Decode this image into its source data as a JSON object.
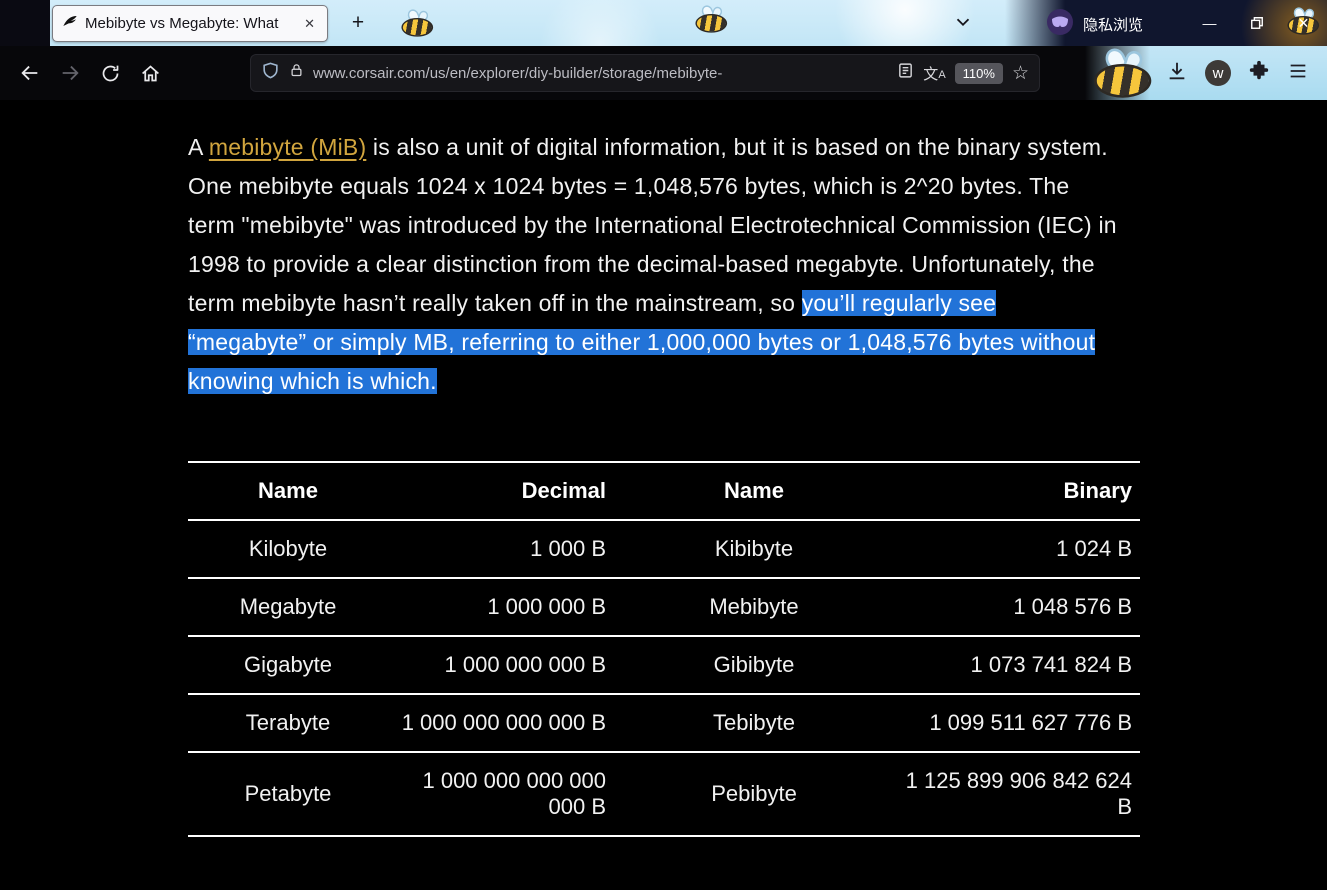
{
  "browser": {
    "tab": {
      "title": "Mebibyte vs Megabyte: What",
      "close_glyph": "✕"
    },
    "new_tab_glyph": "+",
    "private_label": "隐私浏览",
    "window_controls": {
      "minimize": "—",
      "close": "✕"
    },
    "url": "www.corsair.com/us/en/explorer/diy-builder/storage/mebibyte-",
    "zoom_level": "110%",
    "icons": {
      "star": "☆",
      "translate_cjk": "文",
      "translate_latin": "A",
      "w_badge": "w"
    }
  },
  "content": {
    "paragraph": {
      "pre_link": "A ",
      "link": "mebibyte (MiB)",
      "mid": " is also a unit of digital information, but it is based on the binary system. One mebibyte equals 1024 x 1024 bytes = 1,048,576 bytes, which is 2^20 bytes. The term \"mebibyte\" was introduced by the International Electrotechnical Commission (IEC) in 1998 to provide a clear distinction from the decimal-based megabyte. Unfortunately, the term mebibyte hasn’t really taken off in the mainstream, so ",
      "selected": "you’ll regularly see “megabyte” or simply MB, referring to either 1,000,000 bytes or 1,048,576 bytes without knowing which is which."
    },
    "table": {
      "headers": [
        "Name",
        "Decimal",
        "Name",
        "Binary"
      ],
      "rows": [
        [
          "Kilobyte",
          "1 000 B",
          "Kibibyte",
          "1 024 B"
        ],
        [
          "Megabyte",
          "1 000 000 B",
          "Mebibyte",
          "1 048 576 B"
        ],
        [
          "Gigabyte",
          "1 000 000 000 B",
          "Gibibyte",
          "1 073 741 824 B"
        ],
        [
          "Terabyte",
          "1 000 000 000 000 B",
          "Tebibyte",
          "1 099 511 627 776 B"
        ],
        [
          "Petabyte",
          "1 000 000 000 000 000 B",
          "Pebibyte",
          "1 125 899 906 842 624 B"
        ]
      ]
    }
  },
  "colors": {
    "link": "#d1a53e",
    "selection": "#2273d8",
    "page_bg": "#000000"
  }
}
